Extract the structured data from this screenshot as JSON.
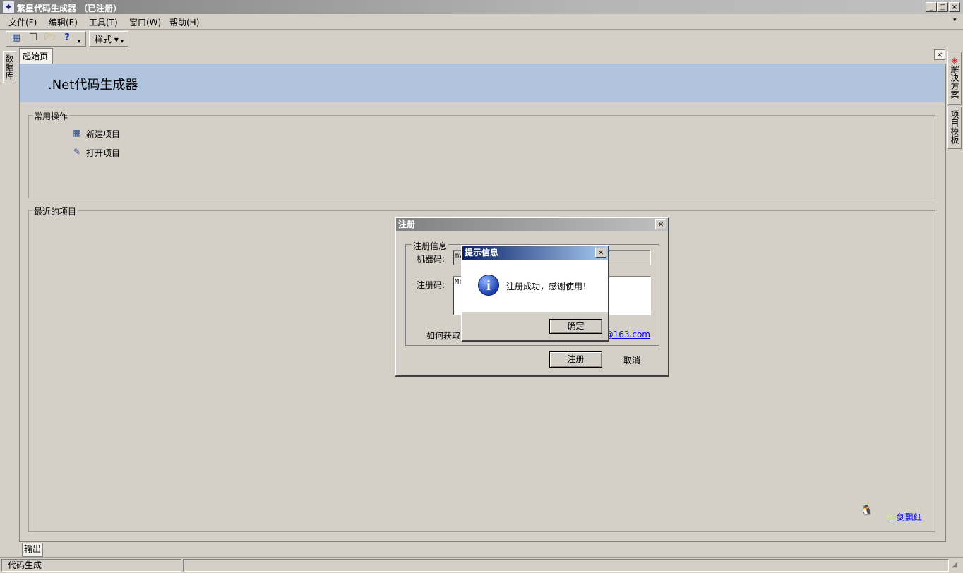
{
  "window": {
    "title": "繁星代码生成器 （已注册）",
    "min_label": "_",
    "max_label": "□",
    "close_label": "×"
  },
  "menu": [
    "文件(F)",
    "编辑(E)",
    "工具(T)",
    "窗口(W)",
    "帮助(H)"
  ],
  "toolbar": {
    "style_label": "样式"
  },
  "left_dock": {
    "tab_label": "数据库"
  },
  "right_dock": {
    "tab1_label": "解决方案",
    "tab2_label": "项目模板"
  },
  "doc": {
    "tab_label": "起始页",
    "close_label": "×",
    "banner_title": ".Net代码生成器",
    "common_ops": {
      "label": "常用操作",
      "items": [
        "新建项目",
        "打开项目"
      ]
    },
    "recent": {
      "label": "最近的项目"
    },
    "author_link": "一剑飘红"
  },
  "register_dialog": {
    "title": "注册",
    "close_label": "×",
    "group_label": "注册信息",
    "machine_label": "机器码:",
    "machine_value": "mv",
    "reg_label": "注册码:",
    "reg_value": "M:",
    "how_text": "如何获取",
    "email_fragment": "0@163.com",
    "register_button": "注册",
    "cancel_button": "取消"
  },
  "message_dialog": {
    "title": "提示信息",
    "close_label": "×",
    "icon_glyph": "i",
    "message": "注册成功，感谢使用！",
    "ok_button": "确定"
  },
  "output_tab": "输出",
  "status": {
    "left": "代码生成"
  }
}
